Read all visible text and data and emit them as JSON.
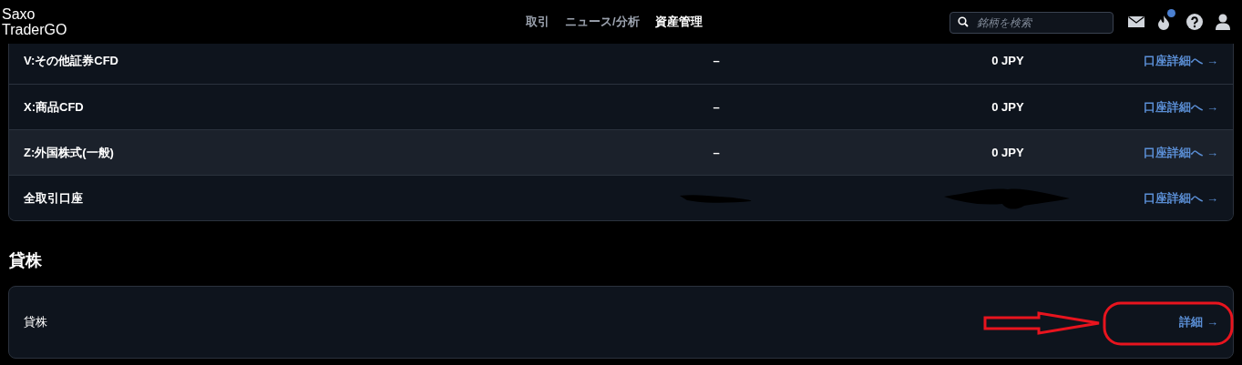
{
  "header": {
    "logo": [
      "Saxo",
      "TraderGO"
    ],
    "nav": [
      {
        "label": "取引",
        "selected": false
      },
      {
        "label": "ニュース/分析",
        "selected": false
      },
      {
        "label": "資産管理",
        "selected": true
      }
    ],
    "search": {
      "placeholder": "銘柄を検索"
    },
    "notification_badge": true
  },
  "accounts": {
    "rows": [
      {
        "name": "V:その他証券CFD",
        "column_2": "–",
        "column_3": "0 JPY",
        "link": "口座詳細へ →",
        "hovered": false,
        "redacted": false
      },
      {
        "name": "X:商品CFD",
        "column_2": "–",
        "column_3": "0 JPY",
        "link": "口座詳細へ →",
        "hovered": false,
        "redacted": false
      },
      {
        "name": "Z:外国株式(一般)",
        "column_2": "–",
        "column_3": "0 JPY",
        "link": "口座詳細へ →",
        "hovered": true,
        "redacted": false
      },
      {
        "name": "全取引口座",
        "link": "口座詳細へ →",
        "hovered": false,
        "redacted": true
      }
    ]
  },
  "lending": {
    "title": "貸株",
    "rows": [
      {
        "name": "貸株",
        "link": "詳細 →"
      }
    ]
  }
}
